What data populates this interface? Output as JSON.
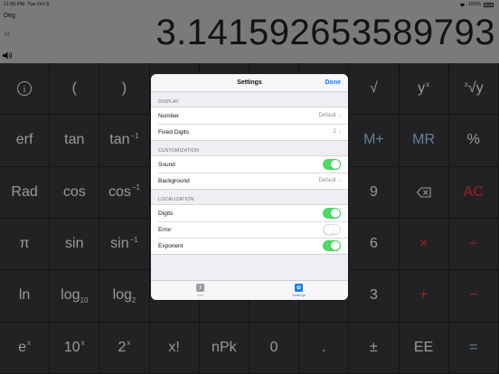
{
  "status": {
    "time": "11:56 PM",
    "date": "Tue Oct 8",
    "battery": "100%"
  },
  "display": {
    "mode": "Deg",
    "memory": "M",
    "value": "3.141592653589793"
  },
  "keys": [
    {
      "t": "",
      "icon": "info-icon"
    },
    {
      "t": "("
    },
    {
      "t": ")"
    },
    {
      "t": ""
    },
    {
      "t": ""
    },
    {
      "t": ""
    },
    {
      "t": ""
    },
    {
      "t": "√",
      "sup": ""
    },
    {
      "t": "y",
      "sup": "x"
    },
    {
      "t": "√y",
      "pre": "x"
    },
    {
      "t": "erf"
    },
    {
      "t": "tan"
    },
    {
      "t": "tan",
      "sup": "−1"
    },
    {
      "t": ""
    },
    {
      "t": ""
    },
    {
      "t": ""
    },
    {
      "t": ""
    },
    {
      "t": "M+",
      "c": "blue"
    },
    {
      "t": "MR",
      "c": "blue"
    },
    {
      "t": "%"
    },
    {
      "t": "Rad"
    },
    {
      "t": "cos"
    },
    {
      "t": "cos",
      "sup": "−1"
    },
    {
      "t": ""
    },
    {
      "t": ""
    },
    {
      "t": ""
    },
    {
      "t": ""
    },
    {
      "t": "9"
    },
    {
      "t": "",
      "icon": "backspace-icon"
    },
    {
      "t": "AC",
      "c": "red"
    },
    {
      "t": "π"
    },
    {
      "t": "sin"
    },
    {
      "t": "sin",
      "sup": "−1"
    },
    {
      "t": ""
    },
    {
      "t": ""
    },
    {
      "t": ""
    },
    {
      "t": ""
    },
    {
      "t": "6"
    },
    {
      "t": "×",
      "c": "red"
    },
    {
      "t": "÷",
      "c": "red"
    },
    {
      "t": "ln"
    },
    {
      "t": "log",
      "sub": "10"
    },
    {
      "t": "log",
      "sub": "2"
    },
    {
      "t": ""
    },
    {
      "t": ""
    },
    {
      "t": ""
    },
    {
      "t": ""
    },
    {
      "t": "3"
    },
    {
      "t": "+",
      "c": "red"
    },
    {
      "t": "−",
      "c": "red"
    },
    {
      "t": "e",
      "sup": "x"
    },
    {
      "t": "10",
      "sup": "x"
    },
    {
      "t": "2",
      "sup": "x"
    },
    {
      "t": "x!"
    },
    {
      "t": "nPk"
    },
    {
      "t": "0"
    },
    {
      "t": "."
    },
    {
      "t": "±"
    },
    {
      "t": "EE"
    },
    {
      "t": "=",
      "c": "blue"
    }
  ],
  "settings": {
    "title": "Settings",
    "done": "Done",
    "display_section": "DISPLAY",
    "number_label": "Number",
    "number_value": "Default",
    "fixed_label": "Fixed Digits",
    "fixed_value": "2",
    "custom_section": "CUSTOMIZATION",
    "sound_label": "Sound",
    "sound_on": true,
    "background_label": "Background",
    "background_value": "Default",
    "local_section": "LOCALIZATION",
    "digits_label": "Digits",
    "digits_on": true,
    "error_label": "Error",
    "error_on": false,
    "exponent_label": "Exponent",
    "exponent_on": true
  },
  "tabs": [
    {
      "label": "Info",
      "icon": "info-tab-icon",
      "active": false
    },
    {
      "label": "Settings",
      "icon": "gear-tab-icon",
      "active": true
    }
  ],
  "colors": {
    "accent": "#1a7cf5",
    "toggle_on": "#4cd964",
    "red_key": "#e0302d",
    "blue_key": "#8eb1d6"
  }
}
